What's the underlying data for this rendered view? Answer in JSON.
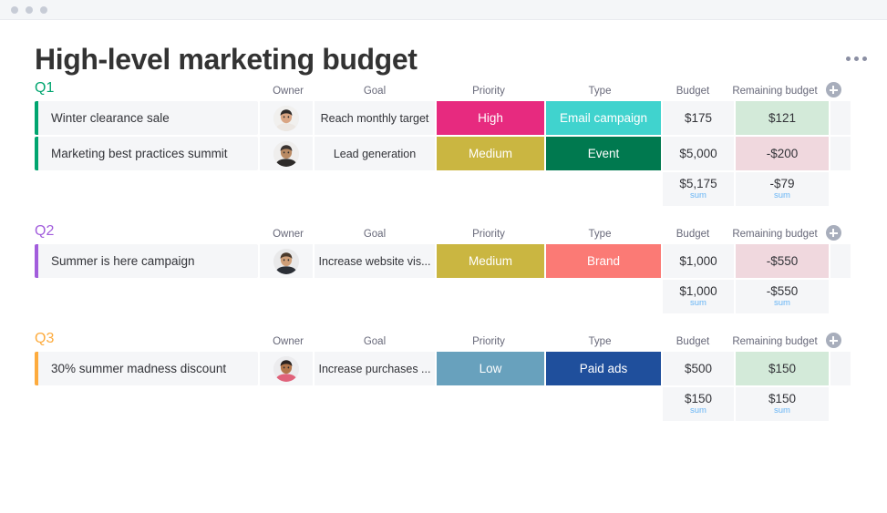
{
  "window": {
    "titlebar_dots": [
      "dot",
      "dot",
      "dot"
    ]
  },
  "header": {
    "title": "High-level marketing budget",
    "menu_icon": "kebab-menu-icon"
  },
  "columns": {
    "item": "",
    "owner": "Owner",
    "goal": "Goal",
    "priority": "Priority",
    "type": "Type",
    "budget": "Budget",
    "remaining": "Remaining budget",
    "add": "add-column-icon"
  },
  "colors": {
    "q1": "#00a56f",
    "q2": "#a25ddc",
    "q3": "#fdab3d",
    "high": "#e72a7f",
    "medium": "#cab641",
    "low": "#68a1bd",
    "email_campaign": "#40d3ce",
    "event": "#00794f",
    "brand": "#fb7a75",
    "paid_ads": "#1f4f9c",
    "positive_budget_bg": "#d3ead9",
    "negative_budget_bg": "#f0d8de",
    "cell_bg": "#f5f6f8",
    "sum_label": "#66b4f5"
  },
  "groups": [
    {
      "label": "Q1",
      "color_key": "q1",
      "rows": [
        {
          "name": "Winter clearance sale",
          "owner": "avatar-woman",
          "goal": "Reach monthly target",
          "priority": "High",
          "priority_color_key": "high",
          "type": "Email campaign",
          "type_color_key": "email_campaign",
          "budget": "$175",
          "remaining": "$121",
          "remaining_sign": "positive"
        },
        {
          "name": "Marketing best practices summit",
          "owner": "avatar-man-beard",
          "goal": "Lead generation",
          "priority": "Medium",
          "priority_color_key": "medium",
          "type": "Event",
          "type_color_key": "event",
          "budget": "$5,000",
          "remaining": "-$200",
          "remaining_sign": "negative"
        }
      ],
      "sum": {
        "budget": "$5,175",
        "budget_label": "sum",
        "remaining": "-$79",
        "remaining_label": "sum"
      }
    },
    {
      "label": "Q2",
      "color_key": "q2",
      "rows": [
        {
          "name": "Summer is here campaign",
          "owner": "avatar-man-short-hair",
          "goal": "Increase website vis...",
          "priority": "Medium",
          "priority_color_key": "medium",
          "type": "Brand",
          "type_color_key": "brand",
          "budget": "$1,000",
          "remaining": "-$550",
          "remaining_sign": "negative"
        }
      ],
      "sum": {
        "budget": "$1,000",
        "budget_label": "sum",
        "remaining": "-$550",
        "remaining_label": "sum"
      }
    },
    {
      "label": "Q3",
      "color_key": "q3",
      "rows": [
        {
          "name": "30% summer madness discount",
          "owner": "avatar-man-curly",
          "goal": "Increase purchases ...",
          "priority": "Low",
          "priority_color_key": "low",
          "type": "Paid ads",
          "type_color_key": "paid_ads",
          "budget": "$500",
          "remaining": "$150",
          "remaining_sign": "positive"
        }
      ],
      "sum": {
        "budget": "$150",
        "budget_label": "sum",
        "remaining": "$150",
        "remaining_label": "sum"
      }
    }
  ]
}
